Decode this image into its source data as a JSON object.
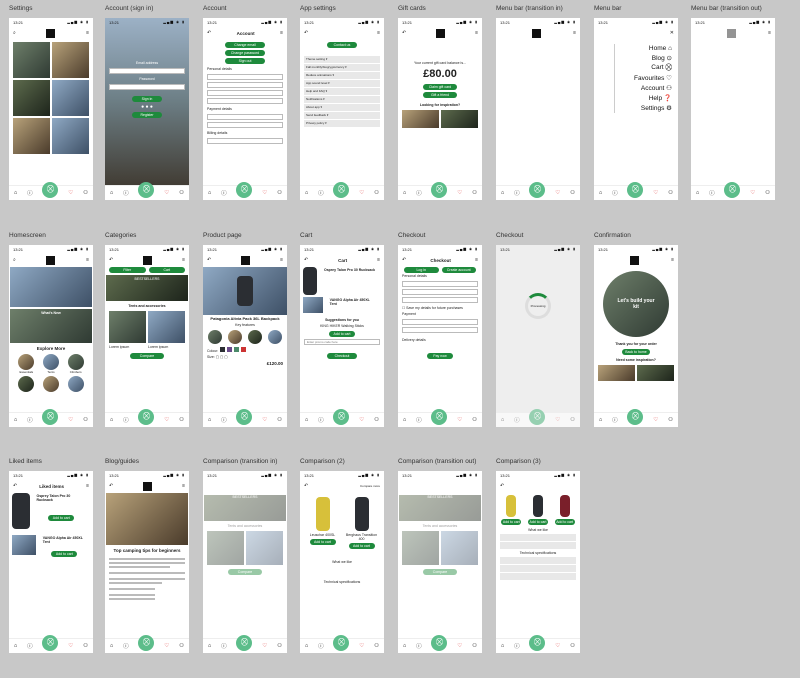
{
  "frames": {
    "settings": "Settings",
    "account_sign_in": "Account (sign in)",
    "account": "Account",
    "app_settings": "App settings",
    "gift_cards": "Gift cards",
    "menu_bar_transition_in": "Menu bar (transition in)",
    "menu_bar": "Menu bar",
    "menu_bar_transition_out": "Menu bar (transition out)",
    "homescreen": "Homescreen",
    "categories": "Categories",
    "product_page": "Product page",
    "cart": "Cart",
    "checkout": "Checkout",
    "checkout2": "Checkout",
    "confirmation": "Confirmation",
    "liked_items": "Liked items",
    "blog_guides": "Blog/guides",
    "comparison_transition_in": "Comparison (transition in)",
    "comparison_2": "Comparison (2)",
    "comparison_transition_out": "Comparison (transition out)",
    "comparison_3": "Comparison (3)"
  },
  "status_time": "13:21",
  "signin": {
    "email": "Email address",
    "password": "Password",
    "sign_in": "Sign in",
    "register": "Register"
  },
  "account": {
    "title": "Account",
    "change_email": "Change email",
    "change_password": "Change password",
    "sign_out": "Sign out",
    "personal_details": "Personal details",
    "payment_details": "Payment details",
    "billing_details": "Billing details"
  },
  "app_settings": {
    "contact": "Contact us",
    "rows": [
      "Theme setting ▾",
      "Fall monthly/biogrygcurrency ▾",
      "Reduce animations ▾",
      "App sound level ▾",
      "Help and FAQ ▾",
      "Notifications ▾",
      "About app ▾",
      "Send feedback ▾",
      "Privacy policy ▾"
    ]
  },
  "gift": {
    "balance_label": "Your current gift card balance is...",
    "balance": "£80.00",
    "claim": "Claim gift card",
    "gift_friend": "Gift a friend",
    "inspiration": "Looking for inspiration?"
  },
  "menu": {
    "items": [
      "Home ⌂",
      "Blog ⊙",
      "Cart ⛒",
      "Favourites ♡",
      "Account ⚇",
      "Help ❓",
      "Settings ⚙"
    ]
  },
  "home": {
    "explore": "Explore More",
    "what_new": "What's New",
    "cats": [
      "Essentials",
      "Tents",
      "Climbers",
      "",
      "",
      ""
    ]
  },
  "categories": {
    "filter": "Filter",
    "cart": "Cart",
    "bestsellers": "BESTSELLERS",
    "tents": "Tents and accessories",
    "item": "Lorem ipsum",
    "compare": "Compare"
  },
  "product": {
    "name": "Patagonia Altvia Pack 36L Backpack",
    "features": "Key features",
    "colour": "Colour:",
    "size": "Size:",
    "price": "£120.00"
  },
  "cart": {
    "title": "Cart",
    "item1": "Osprey Talon Pro 30 Rucksack",
    "item2": "VANGO Alpha Air 450XL Tent",
    "suggestions": "Suggestions for you",
    "suggest_item": "KING HIKER Walking Sticks",
    "promo": "Enter promo code here",
    "checkout": "Checkout",
    "add": "Add to cart"
  },
  "checkout": {
    "title": "Checkout",
    "log_in": "Log in",
    "create": "Create account",
    "personal": "Personal details",
    "save": "Save my details for future purchases",
    "payment": "Payment",
    "delivery": "Delivery details",
    "pay_now": "Pay now",
    "processing": "Processing"
  },
  "confirmation": {
    "circle": "Let's build your kit",
    "thanks": "Thank you for your order",
    "back": "Back to home",
    "need": "Need some inspiration?"
  },
  "liked": {
    "title": "Liked items",
    "item1": "Osprey Talon Pro 30 Rucksack",
    "item2": "VANGO Alpha Air 450XL Tent",
    "add": "Add to cart"
  },
  "blog": {
    "title": "Top camping tips for beginners"
  },
  "comparison": {
    "compare_more": "Compare more",
    "p1": "Leuschar 400SL",
    "p2": "Berghaus Transition 400",
    "what": "What we like",
    "tech": "Technical specifications",
    "add": "Add to cart"
  },
  "nav_icons": [
    "home-icon",
    "blog-icon",
    "cart-icon",
    "heart-icon",
    "account-icon"
  ],
  "colors": {
    "accent": "#1e8a3c",
    "fab": "#5cbd8a",
    "background": "#c8c8c8"
  }
}
